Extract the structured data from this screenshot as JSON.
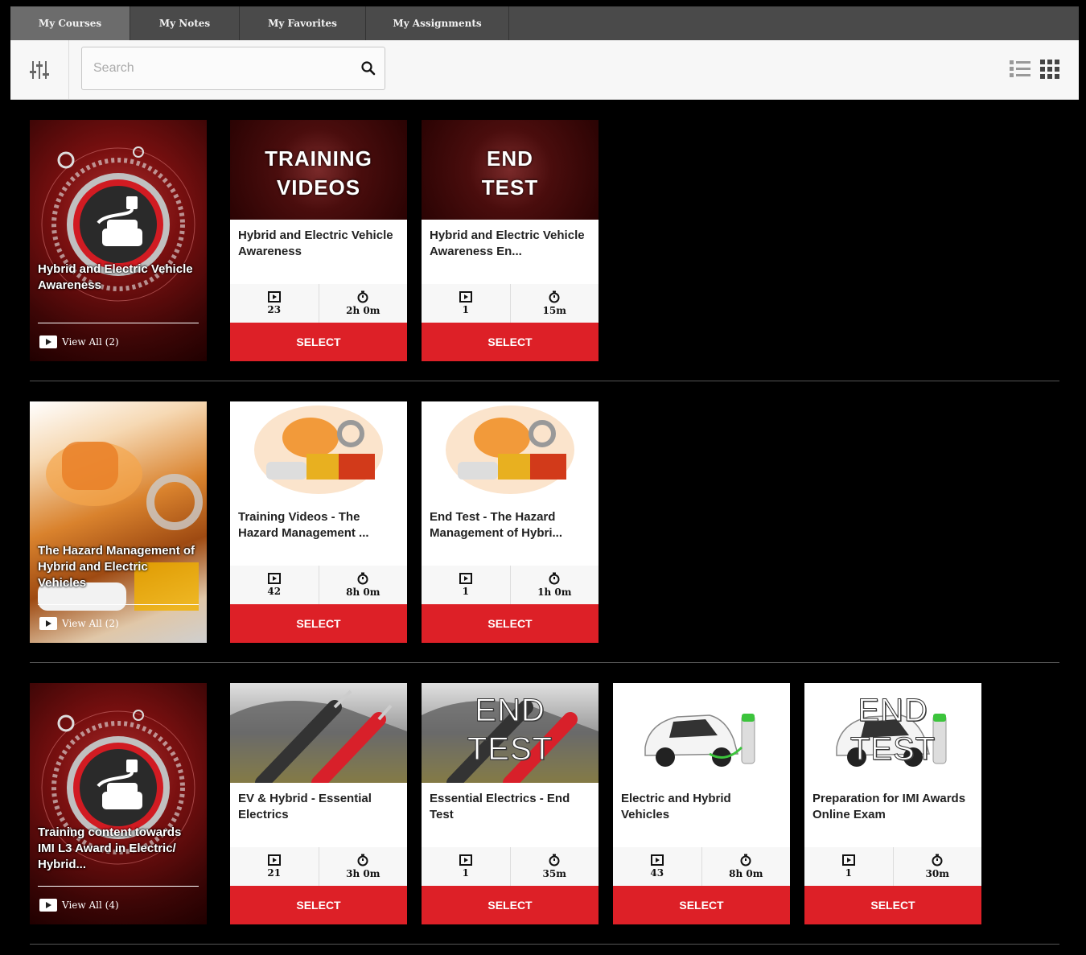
{
  "tabs": [
    {
      "label": "My Courses",
      "active": true
    },
    {
      "label": "My Notes"
    },
    {
      "label": "My Favorites"
    },
    {
      "label": "My Assignments"
    }
  ],
  "search": {
    "placeholder": "Search"
  },
  "colors": {
    "accent_red": "#dd2027",
    "tab_bar": "#4a4a4a",
    "toolbar": "#f7f7f7"
  },
  "icons": [
    "filter-sliders-icon",
    "search-icon",
    "list-view-icon",
    "grid-view-icon",
    "video-icon",
    "stopwatch-icon",
    "play-folder-icon"
  ],
  "rows": [
    {
      "category": {
        "title": "Hybrid and Electric Vehicle Awareness",
        "view_all": "View All (2)"
      },
      "cards": [
        {
          "thumb_text": "TRAINING VIDEOS",
          "title": "Hybrid and Electric Vehicle Awareness",
          "videos": "23",
          "duration": "2h 0m",
          "select": "SELECT"
        },
        {
          "thumb_text": "END TEST",
          "title": "Hybrid and Electric Vehicle Awareness En...",
          "videos": "1",
          "duration": "15m",
          "select": "SELECT"
        }
      ]
    },
    {
      "category": {
        "title": "The Hazard Management of Hybrid and Electric Vehicles",
        "view_all": "View All (2)"
      },
      "cards": [
        {
          "title": "Training Videos - The Hazard Management ...",
          "videos": "42",
          "duration": "8h 0m",
          "select": "SELECT"
        },
        {
          "title": "End Test - The Hazard Management of Hybri...",
          "videos": "1",
          "duration": "1h 0m",
          "select": "SELECT"
        }
      ]
    },
    {
      "category": {
        "title": "Training content towards IMI L3 Award in Electric/ Hybrid...",
        "view_all": "View All (4)"
      },
      "cards": [
        {
          "title": "EV & Hybrid - Essential Electrics",
          "videos": "21",
          "duration": "3h 0m",
          "select": "SELECT"
        },
        {
          "thumb_text": "END TEST",
          "title": "Essential Electrics - End Test",
          "videos": "1",
          "duration": "35m",
          "select": "SELECT"
        },
        {
          "title": "Electric and Hybrid Vehicles",
          "videos": "43",
          "duration": "8h 0m",
          "select": "SELECT"
        },
        {
          "thumb_text": "END TEST",
          "title": "Preparation for IMI Awards Online Exam",
          "videos": "1",
          "duration": "30m",
          "select": "SELECT"
        }
      ]
    }
  ]
}
